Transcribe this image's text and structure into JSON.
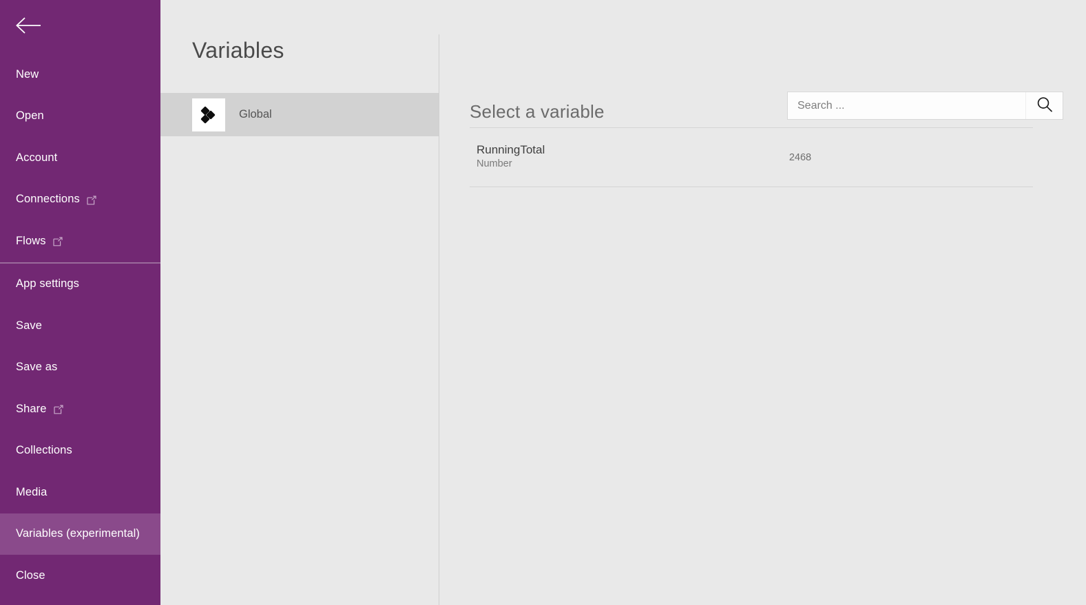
{
  "sidebar": {
    "back_icon": "back-arrow-icon",
    "accent_color": "#722873",
    "selected_color": "#8a4a8b",
    "items": [
      {
        "label": "New",
        "external": false,
        "selected": false,
        "separator_after": false
      },
      {
        "label": "Open",
        "external": false,
        "selected": false,
        "separator_after": false
      },
      {
        "label": "Account",
        "external": false,
        "selected": false,
        "separator_after": false
      },
      {
        "label": "Connections",
        "external": true,
        "selected": false,
        "separator_after": false
      },
      {
        "label": "Flows",
        "external": true,
        "selected": false,
        "separator_after": true
      },
      {
        "label": "App settings",
        "external": false,
        "selected": false,
        "separator_after": false
      },
      {
        "label": "Save",
        "external": false,
        "selected": false,
        "separator_after": false
      },
      {
        "label": "Save as",
        "external": false,
        "selected": false,
        "separator_after": false
      },
      {
        "label": "Share",
        "external": true,
        "selected": false,
        "separator_after": false
      },
      {
        "label": "Collections",
        "external": false,
        "selected": false,
        "separator_after": false
      },
      {
        "label": "Media",
        "external": false,
        "selected": false,
        "separator_after": false
      },
      {
        "label": "Variables (experimental)",
        "external": false,
        "selected": true,
        "separator_after": false
      },
      {
        "label": "Close",
        "external": false,
        "selected": false,
        "separator_after": false
      }
    ]
  },
  "middle": {
    "title": "Variables",
    "items": [
      {
        "label": "Global",
        "icon": "global-variables-icon",
        "selected": true
      }
    ]
  },
  "main": {
    "title": "Select a variable",
    "search": {
      "value": "",
      "placeholder": "Search ...",
      "icon": "search-icon"
    },
    "variables": [
      {
        "name": "RunningTotal",
        "type": "Number",
        "value": "2468"
      }
    ]
  }
}
